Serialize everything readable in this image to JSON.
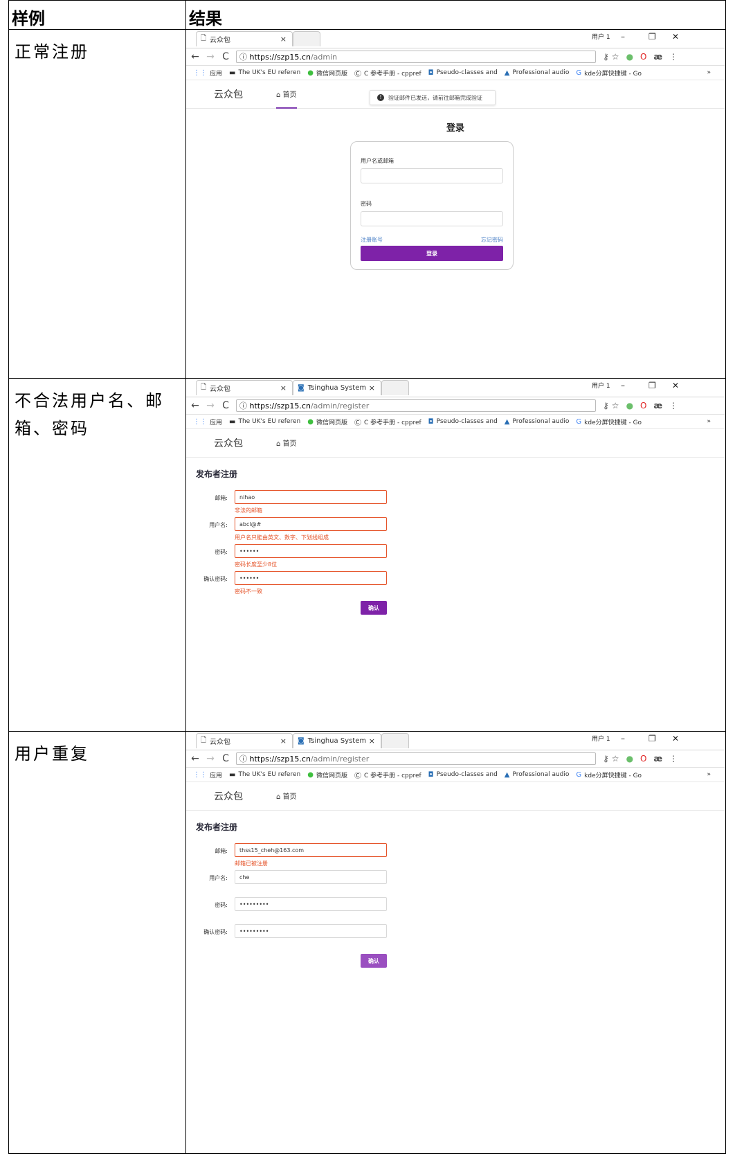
{
  "table": {
    "header_example": "样例",
    "header_result": "结果"
  },
  "rows": [
    {
      "case": "正常注册"
    },
    {
      "case": "不合法用户名、邮箱、密码"
    },
    {
      "case": "用户重复"
    }
  ],
  "browser": {
    "window_user": "用户 1",
    "bookmarks": [
      "应用",
      "The UK's EU referen",
      "微信网页版",
      "C 参考手册 - cppref",
      "Pseudo-classes and",
      "Professional audio",
      "kde分屏快捷键 - Go"
    ],
    "more": "»"
  },
  "shot1": {
    "tab_title": "云众包",
    "url_domain": "https://szp15.cn",
    "url_path": "/admin",
    "brand": "云众包",
    "home": "首页",
    "notice": "验证邮件已发送，请前往邮箱完成验证",
    "login_title": "登录",
    "user_label": "用户名或邮箱",
    "password_label": "密码",
    "register_link": "注册账号",
    "forgot_link": "忘记密码",
    "login_button": "登录"
  },
  "shot2": {
    "tab_title": "云众包",
    "tab2_title": "Tsinghua System",
    "url_domain": "https://szp15.cn",
    "url_path": "/admin/register",
    "brand": "云众包",
    "home": "首页",
    "form_title": "发布者注册",
    "email_label": "邮箱:",
    "email_value": "nihao",
    "email_error": "非法的邮箱",
    "username_label": "用户名:",
    "username_value": "abcl@#",
    "username_error": "用户名只能由英文、数字、下划线组成",
    "password_label": "密码:",
    "password_value": "••••••",
    "password_error": "密码长度至少8位",
    "confirm_label": "确认密码:",
    "confirm_value": "••••••",
    "confirm_error": "密码不一致",
    "confirm_button": "确认"
  },
  "shot3": {
    "tab_title": "云众包",
    "tab2_title": "Tsinghua System",
    "url_domain": "https://szp15.cn",
    "url_path": "/admin/register",
    "brand": "云众包",
    "home": "首页",
    "form_title": "发布者注册",
    "email_label": "邮箱:",
    "email_value": "thss15_cheh@163.com",
    "email_error": "邮箱已被注册",
    "username_label": "用户名:",
    "username_value": "che",
    "password_label": "密码:",
    "password_value": "•••••••••",
    "confirm_label": "确认密码:",
    "confirm_value": "•••••••••",
    "confirm_button": "确认"
  }
}
